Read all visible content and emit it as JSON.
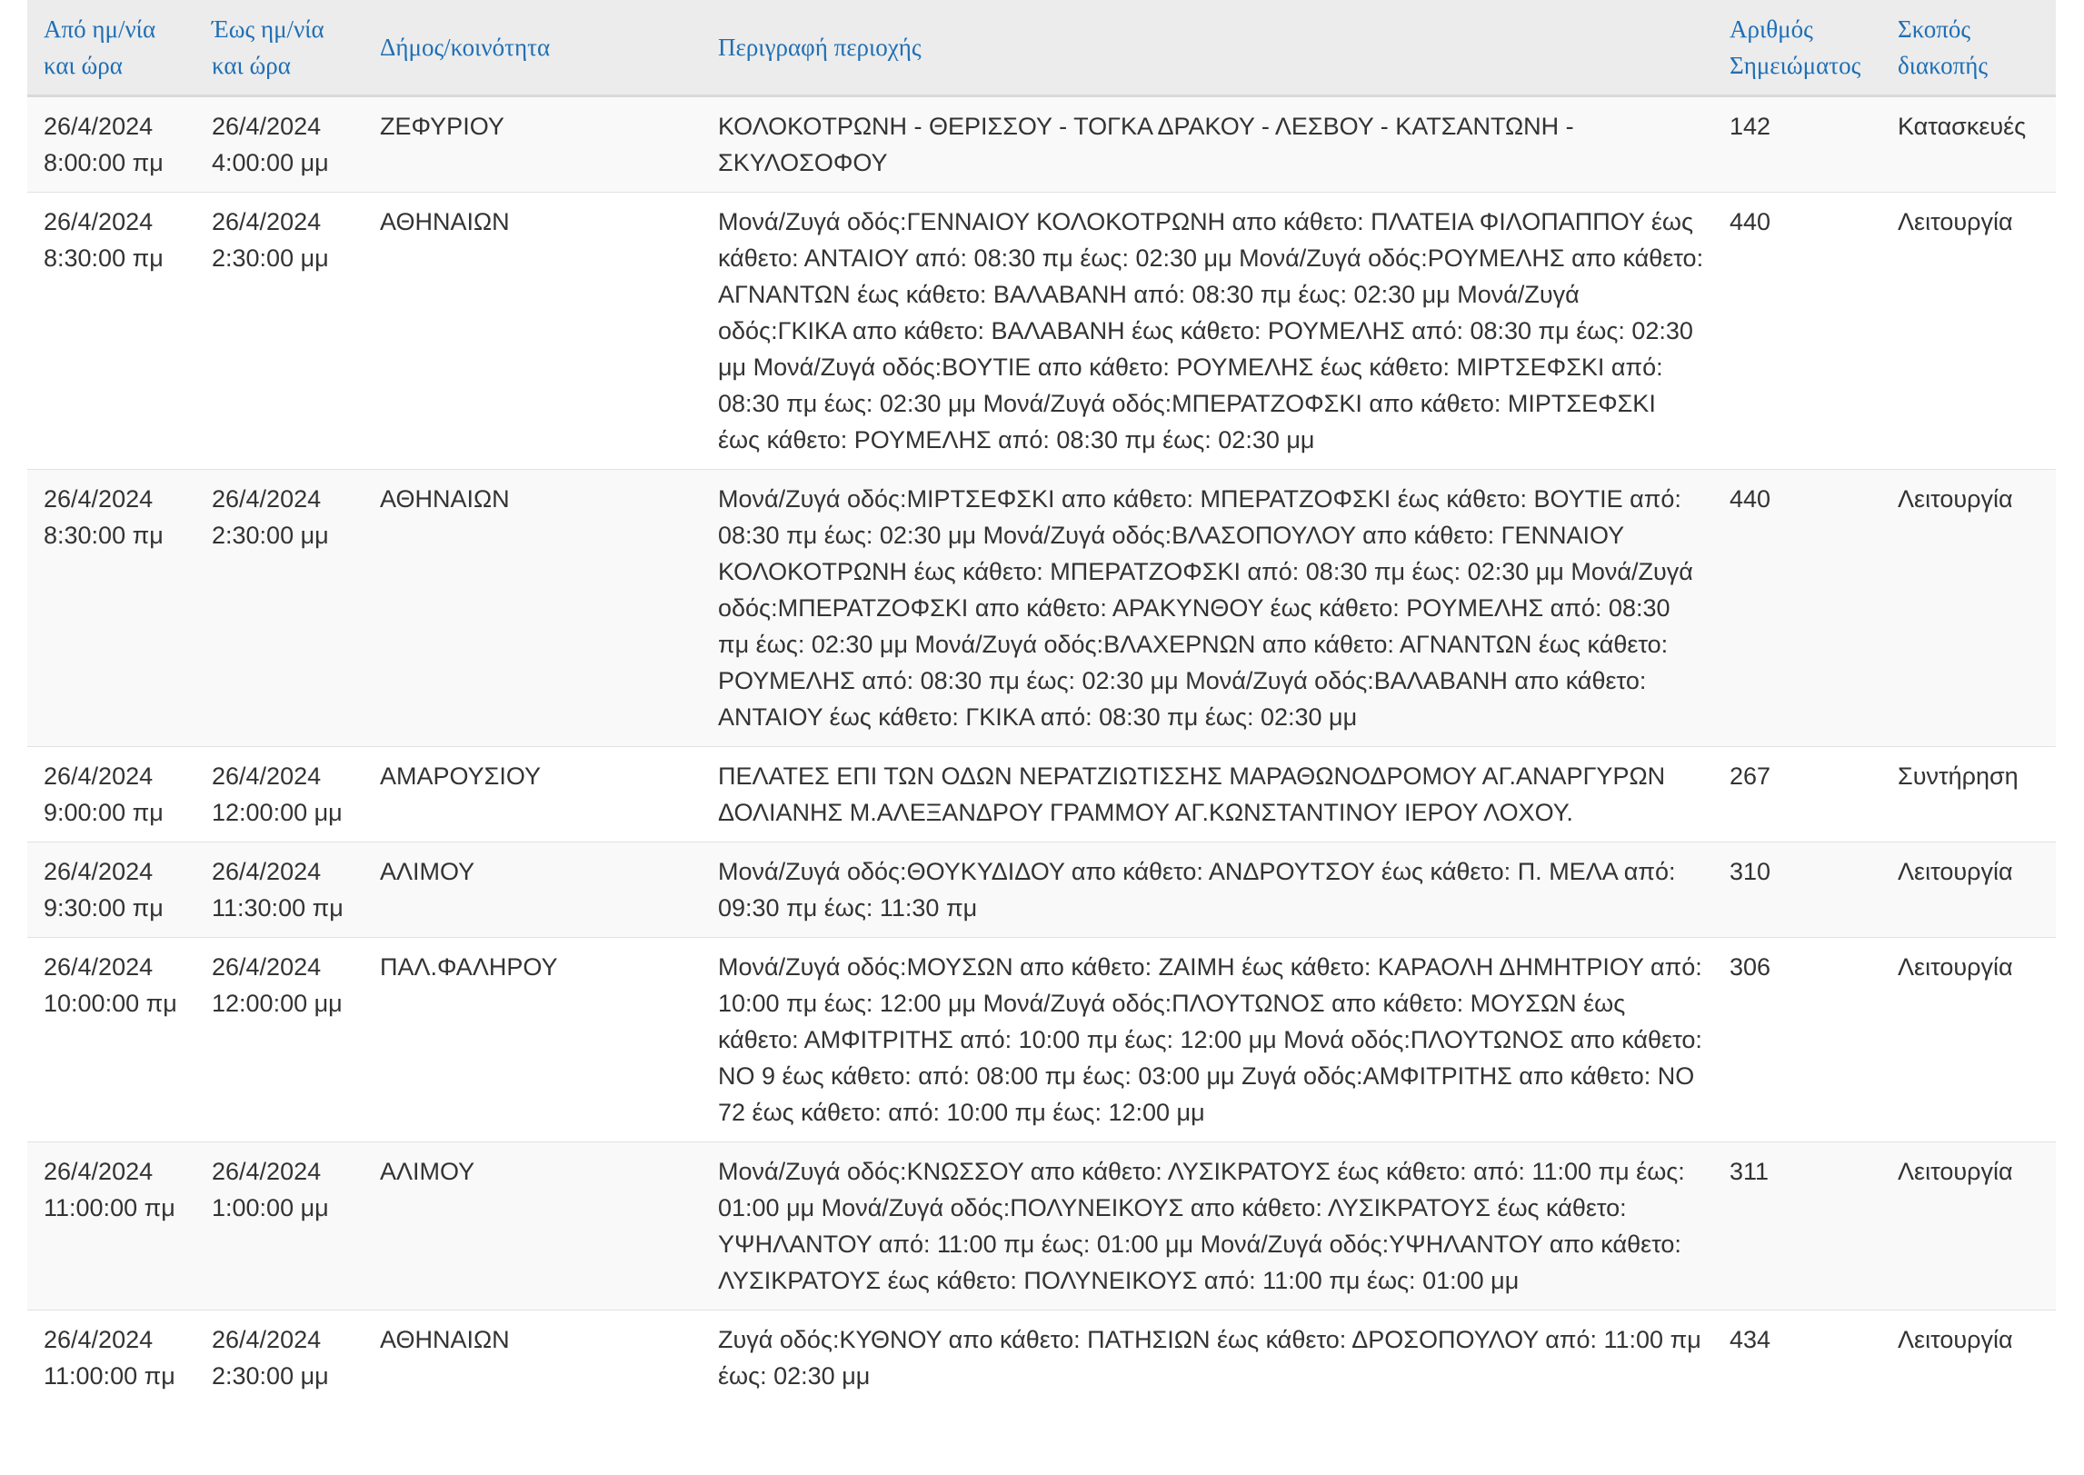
{
  "table": {
    "headers": {
      "from": [
        "Από ημ/νία",
        "και ώρα"
      ],
      "to": [
        "Έως ημ/νία",
        "και ώρα"
      ],
      "municipality": "Δήμος/κοινότητα",
      "description": "Περιγραφή περιοχής",
      "number": [
        "Αριθμός",
        "Σημειώματος"
      ],
      "purpose": [
        "Σκοπός",
        "διακοπής"
      ]
    },
    "rows": [
      {
        "from_date": "26/4/2024",
        "from_time": "8:00:00 πμ",
        "to_date": "26/4/2024",
        "to_time": "4:00:00 μμ",
        "municipality": "ΖΕΦΥΡΙΟΥ",
        "description": "ΚΟΛΟΚΟΤΡΩΝΗ - ΘΕΡΙΣΣΟΥ - ΤΟΓΚΑ ΔΡΑΚΟΥ - ΛΕΣΒΟΥ - ΚΑΤΣΑΝΤΩΝΗ - ΣΚΥΛΟΣΟΦΟΥ",
        "number": "142",
        "purpose": "Κατασκευές"
      },
      {
        "from_date": "26/4/2024",
        "from_time": "8:30:00 πμ",
        "to_date": "26/4/2024",
        "to_time": "2:30:00 μμ",
        "municipality": "ΑΘΗΝΑΙΩΝ",
        "description": "Μονά/Ζυγά οδός:ΓΕΝΝΑΙΟΥ ΚΟΛΟΚΟΤΡΩΝΗ απο κάθετο: ΠΛΑΤΕΙΑ ΦΙΛΟΠΑΠΠΟΥ έως κάθετο: ΑΝΤΑΙΟΥ από: 08:30 πμ έως: 02:30 μμ Μονά/Ζυγά οδός:ΡΟΥΜΕΛΗΣ απο κάθετο: ΑΓΝΑΝΤΩΝ έως κάθετο: ΒΑΛΑΒΑΝΗ από: 08:30 πμ έως: 02:30 μμ Μονά/Ζυγά οδός:ΓΚΙΚΑ απο κάθετο: ΒΑΛΑΒΑΝΗ έως κάθετο: ΡΟΥΜΕΛΗΣ από: 08:30 πμ έως: 02:30 μμ Μονά/Ζυγά οδός:ΒΟΥΤΙΕ απο κάθετο: ΡΟΥΜΕΛΗΣ έως κάθετο: ΜΙΡΤΣΕΦΣΚΙ από: 08:30 πμ έως: 02:30 μμ Μονά/Ζυγά οδός:ΜΠΕΡΑΤΖΟΦΣΚΙ απο κάθετο: ΜΙΡΤΣΕΦΣΚΙ έως κάθετο: ΡΟΥΜΕΛΗΣ από: 08:30 πμ έως: 02:30 μμ",
        "number": "440",
        "purpose": "Λειτουργία"
      },
      {
        "from_date": "26/4/2024",
        "from_time": "8:30:00 πμ",
        "to_date": "26/4/2024",
        "to_time": "2:30:00 μμ",
        "municipality": "ΑΘΗΝΑΙΩΝ",
        "description": "Μονά/Ζυγά οδός:ΜΙΡΤΣΕΦΣΚΙ απο κάθετο: ΜΠΕΡΑΤΖΟΦΣΚΙ έως κάθετο: ΒΟΥΤΙΕ από: 08:30 πμ έως: 02:30 μμ Μονά/Ζυγά οδός:ΒΛΑΣΟΠΟΥΛΟΥ απο κάθετο: ΓΕΝΝΑΙΟΥ ΚΟΛΟΚΟΤΡΩΝΗ έως κάθετο: ΜΠΕΡΑΤΖΟΦΣΚΙ από: 08:30 πμ έως: 02:30 μμ Μονά/Ζυγά οδός:ΜΠΕΡΑΤΖΟΦΣΚΙ απο κάθετο: ΑΡΑΚΥΝΘΟΥ έως κάθετο: ΡΟΥΜΕΛΗΣ από: 08:30 πμ έως: 02:30 μμ Μονά/Ζυγά οδός:ΒΛΑΧΕΡΝΩΝ απο κάθετο: ΑΓΝΑΝΤΩΝ έως κάθετο: ΡΟΥΜΕΛΗΣ από: 08:30 πμ έως: 02:30 μμ Μονά/Ζυγά οδός:ΒΑΛΑΒΑΝΗ απο κάθετο: ΑΝΤΑΙΟΥ έως κάθετο: ΓΚΙΚΑ από: 08:30 πμ έως: 02:30 μμ",
        "number": "440",
        "purpose": "Λειτουργία"
      },
      {
        "from_date": "26/4/2024",
        "from_time": "9:00:00 πμ",
        "to_date": "26/4/2024",
        "to_time": "12:00:00 μμ",
        "municipality": "ΑΜΑΡΟΥΣΙΟΥ",
        "description": "ΠΕΛΑΤΕΣ ΕΠΙ ΤΩΝ ΟΔΩΝ ΝΕΡΑΤΖΙΩΤΙΣΣΗΣ ΜΑΡΑΘΩΝΟΔΡΟΜΟΥ ΑΓ.ΑΝΑΡΓΥΡΩΝ ΔΟΛΙΑΝΗΣ Μ.ΑΛΕΞΑΝΔΡΟΥ ΓΡΑΜΜΟΥ ΑΓ.ΚΩΝΣΤΑΝΤΙΝΟΥ ΙΕΡΟΥ ΛΟΧΟΥ.",
        "number": "267",
        "purpose": "Συντήρηση"
      },
      {
        "from_date": "26/4/2024",
        "from_time": "9:30:00 πμ",
        "to_date": "26/4/2024",
        "to_time": "11:30:00 πμ",
        "municipality": "ΑΛΙΜΟΥ",
        "description": "Μονά/Ζυγά οδός:ΘΟΥΚΥΔΙΔΟΥ απο κάθετο: ΑΝΔΡΟΥΤΣΟΥ έως κάθετο: Π. ΜΕΛΑ από: 09:30 πμ έως: 11:30 πμ",
        "number": "310",
        "purpose": "Λειτουργία"
      },
      {
        "from_date": "26/4/2024",
        "from_time": "10:00:00 πμ",
        "to_date": "26/4/2024",
        "to_time": "12:00:00 μμ",
        "municipality": "ΠΑΛ.ΦΑΛΗΡΟΥ",
        "description": "Μονά/Ζυγά οδός:ΜΟΥΣΩΝ απο κάθετο: ΖΑΙΜΗ έως κάθετο: ΚΑΡΑΟΛΗ ΔΗΜΗΤΡΙΟΥ από: 10:00 πμ έως: 12:00 μμ Μονά/Ζυγά οδός:ΠΛΟΥΤΩΝΟΣ απο κάθετο: ΜΟΥΣΩΝ έως κάθετο: ΑΜΦΙΤΡΙΤΗΣ από: 10:00 πμ έως: 12:00 μμ Μονά οδός:ΠΛΟΥΤΩΝΟΣ απο κάθετο: ΝΟ 9 έως κάθετο: από: 08:00 πμ έως: 03:00 μμ Ζυγά οδός:ΑΜΦΙΤΡΙΤΗΣ απο κάθετο: ΝΟ 72 έως κάθετο: από: 10:00 πμ έως: 12:00 μμ",
        "number": "306",
        "purpose": "Λειτουργία"
      },
      {
        "from_date": "26/4/2024",
        "from_time": "11:00:00 πμ",
        "to_date": "26/4/2024",
        "to_time": "1:00:00 μμ",
        "municipality": "ΑΛΙΜΟΥ",
        "description": "Μονά/Ζυγά οδός:ΚΝΩΣΣΟΥ απο κάθετο: ΛΥΣΙΚΡΑΤΟΥΣ έως κάθετο: από: 11:00 πμ έως: 01:00 μμ Μονά/Ζυγά οδός:ΠΟΛΥΝΕΙΚΟΥΣ απο κάθετο: ΛΥΣΙΚΡΑΤΟΥΣ έως κάθετο: ΥΨΗΛΑΝΤΟΥ από: 11:00 πμ έως: 01:00 μμ Μονά/Ζυγά οδός:ΥΨΗΛΑΝΤΟΥ απο κάθετο: ΛΥΣΙΚΡΑΤΟΥΣ έως κάθετο: ΠΟΛΥΝΕΙΚΟΥΣ από: 11:00 πμ έως: 01:00 μμ",
        "number": "311",
        "purpose": "Λειτουργία"
      },
      {
        "from_date": "26/4/2024",
        "from_time": "11:00:00 πμ",
        "to_date": "26/4/2024",
        "to_time": "2:30:00 μμ",
        "municipality": "ΑΘΗΝΑΙΩΝ",
        "description": "Ζυγά οδός:ΚΥΘΝΟΥ απο κάθετο: ΠΑΤΗΣΙΩΝ έως κάθετο: ΔΡΟΣΟΠΟΥΛΟΥ από: 11:00 πμ έως: 02:30 μμ",
        "number": "434",
        "purpose": "Λειτουργία"
      }
    ]
  }
}
